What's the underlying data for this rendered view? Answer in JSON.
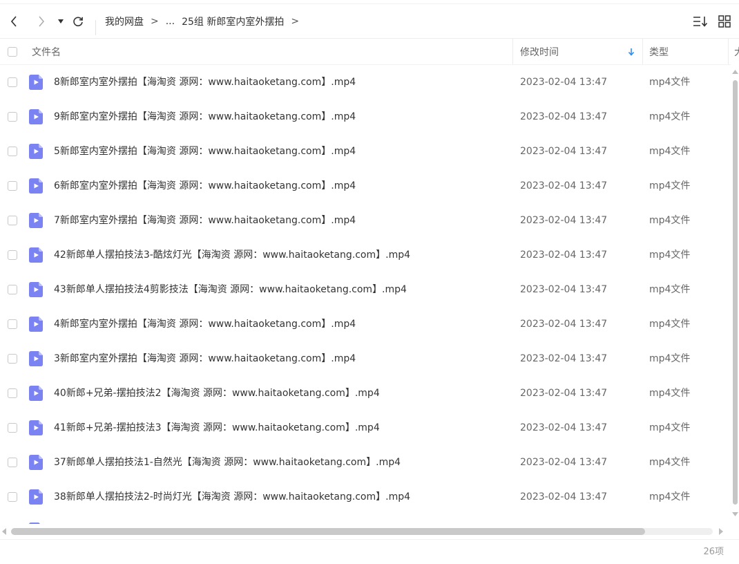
{
  "breadcrumb": {
    "root": "我的网盘",
    "sep1": ">",
    "ellipsis": "...",
    "sep2": ">",
    "current": "25组 新郎室内室外摆拍",
    "sep3": ">"
  },
  "toolbar": {
    "back_icon": "chevron-left-icon",
    "forward_icon": "chevron-right-icon",
    "history_icon": "caret-down-icon",
    "refresh_icon": "refresh-icon",
    "sort_icon": "sort-list-icon",
    "grid_icon": "grid-view-icon"
  },
  "columns": {
    "name": "文件名",
    "modified": "修改时间",
    "type": "类型",
    "size_partial": "大"
  },
  "files": [
    {
      "name": "8新郎室内室外摆拍【海淘资 源网：www.haitaoketang.com】.mp4",
      "time": "2023-02-04 13:47",
      "type": "mp4文件"
    },
    {
      "name": "9新郎室内室外摆拍【海淘资 源网：www.haitaoketang.com】.mp4",
      "time": "2023-02-04 13:47",
      "type": "mp4文件"
    },
    {
      "name": "5新郎室内室外摆拍【海淘资 源网：www.haitaoketang.com】.mp4",
      "time": "2023-02-04 13:47",
      "type": "mp4文件"
    },
    {
      "name": "6新郎室内室外摆拍【海淘资 源网：www.haitaoketang.com】.mp4",
      "time": "2023-02-04 13:47",
      "type": "mp4文件"
    },
    {
      "name": "7新郎室内室外摆拍【海淘资 源网：www.haitaoketang.com】.mp4",
      "time": "2023-02-04 13:47",
      "type": "mp4文件"
    },
    {
      "name": "42新郎单人摆拍技法3-酷炫灯光【海淘资 源网：www.haitaoketang.com】.mp4",
      "time": "2023-02-04 13:47",
      "type": "mp4文件"
    },
    {
      "name": "43新郎单人摆拍技法4剪影技法【海淘资 源网：www.haitaoketang.com】.mp4",
      "time": "2023-02-04 13:47",
      "type": "mp4文件"
    },
    {
      "name": "4新郎室内室外摆拍【海淘资 源网：www.haitaoketang.com】.mp4",
      "time": "2023-02-04 13:47",
      "type": "mp4文件"
    },
    {
      "name": "3新郎室内室外摆拍【海淘资 源网：www.haitaoketang.com】.mp4",
      "time": "2023-02-04 13:47",
      "type": "mp4文件"
    },
    {
      "name": "40新郎+兄弟-摆拍技法2【海淘资 源网：www.haitaoketang.com】.mp4",
      "time": "2023-02-04 13:47",
      "type": "mp4文件"
    },
    {
      "name": "41新郎+兄弟-摆拍技法3【海淘资 源网：www.haitaoketang.com】.mp4",
      "time": "2023-02-04 13:47",
      "type": "mp4文件"
    },
    {
      "name": "37新郎单人摆拍技法1-自然光【海淘资 源网：www.haitaoketang.com】.mp4",
      "time": "2023-02-04 13:47",
      "type": "mp4文件"
    },
    {
      "name": "38新郎单人摆拍技法2-时尚灯光【海淘资 源网：www.haitaoketang.com】.mp4",
      "time": "2023-02-04 13:47",
      "type": "mp4文件"
    }
  ],
  "status": {
    "count": "26项"
  },
  "colors": {
    "accent": "#2e8ef0",
    "file_icon": "#7b83f2",
    "file_icon_fold": "#b9bdf8"
  }
}
